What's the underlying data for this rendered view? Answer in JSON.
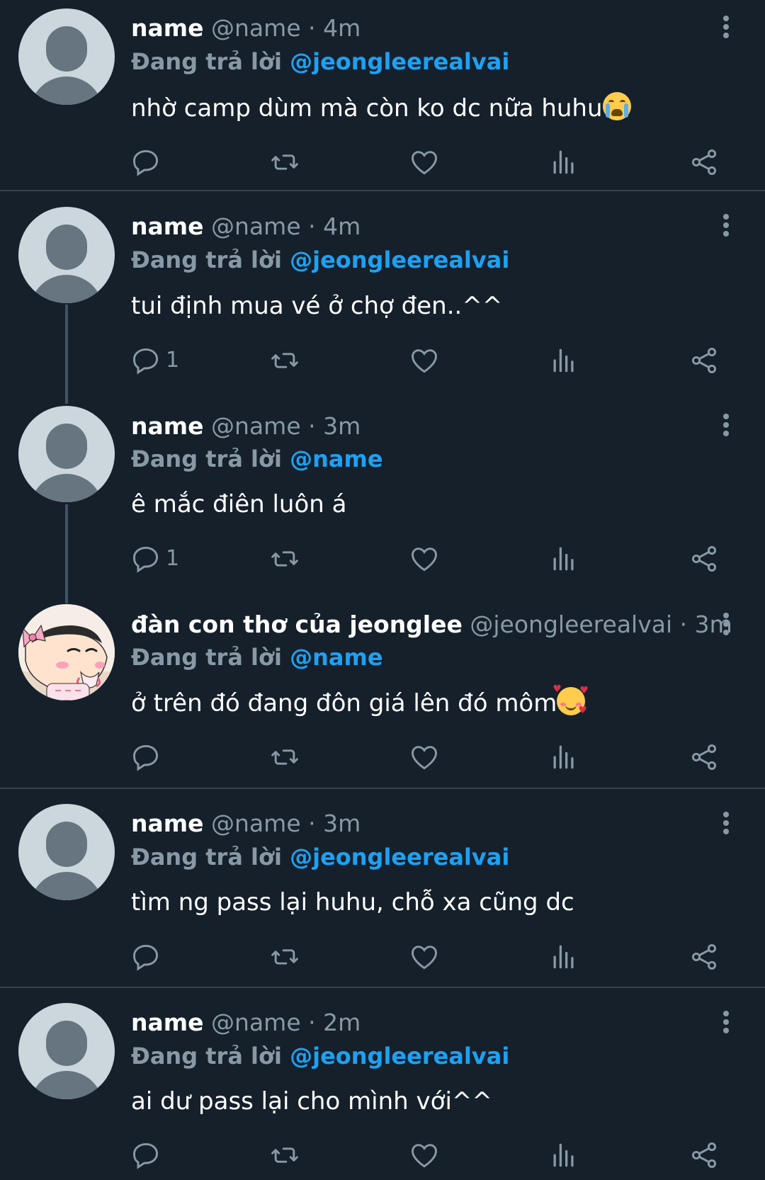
{
  "tweets": [
    {
      "name": "name",
      "handle": "@name",
      "time": "4m",
      "reply_prefix": "Đang trả lời",
      "reply_to": "@jeongleerealvai",
      "text": "nhờ camp dùm mà còn ko dc nữa huhu",
      "emoji": "loudly-crying-face",
      "replies": "",
      "avatar": "default"
    },
    {
      "name": "name",
      "handle": "@name",
      "time": "4m",
      "reply_prefix": "Đang trả lời",
      "reply_to": "@jeongleerealvai",
      "text": "tui định mua vé ở chợ đen..^^",
      "emoji": "",
      "replies": "1",
      "avatar": "default"
    },
    {
      "name": "name",
      "handle": "@name",
      "time": "3m",
      "reply_prefix": "Đang trả lời",
      "reply_to": "@name",
      "text": "ê mắc điên luôn á",
      "emoji": "",
      "replies": "1",
      "avatar": "default"
    },
    {
      "name": "đàn con thơ của jeonglee",
      "handle": "@jeongleerealvai",
      "time": "3m",
      "reply_prefix": "Đang trả lời",
      "reply_to": "@name",
      "text": "ở trên đó đang đôn giá lên đó môm",
      "emoji": "smiling-face-with-hearts",
      "replies": "",
      "avatar": "cartoon"
    },
    {
      "name": "name",
      "handle": "@name",
      "time": "3m",
      "reply_prefix": "Đang trả lời",
      "reply_to": "@jeongleerealvai",
      "text": "tìm ng pass lại huhu, chỗ xa cũng dc",
      "emoji": "",
      "replies": "",
      "avatar": "default"
    },
    {
      "name": "name",
      "handle": "@name",
      "time": "2m",
      "reply_prefix": "Đang trả lời",
      "reply_to": "@jeongleerealvai",
      "text": "ai dư pass lại cho mình với^^",
      "emoji": "",
      "replies": "",
      "avatar": "default"
    }
  ],
  "separator": " · ",
  "icons": {
    "reply": "reply-icon",
    "retweet": "retweet-icon",
    "like": "like-icon",
    "views": "views-icon",
    "share": "share-icon",
    "more": "more-vertical-icon"
  },
  "colors": {
    "background": "#15202b",
    "link": "#1da1f2",
    "muted": "#8899a6",
    "divider": "#38444d"
  }
}
